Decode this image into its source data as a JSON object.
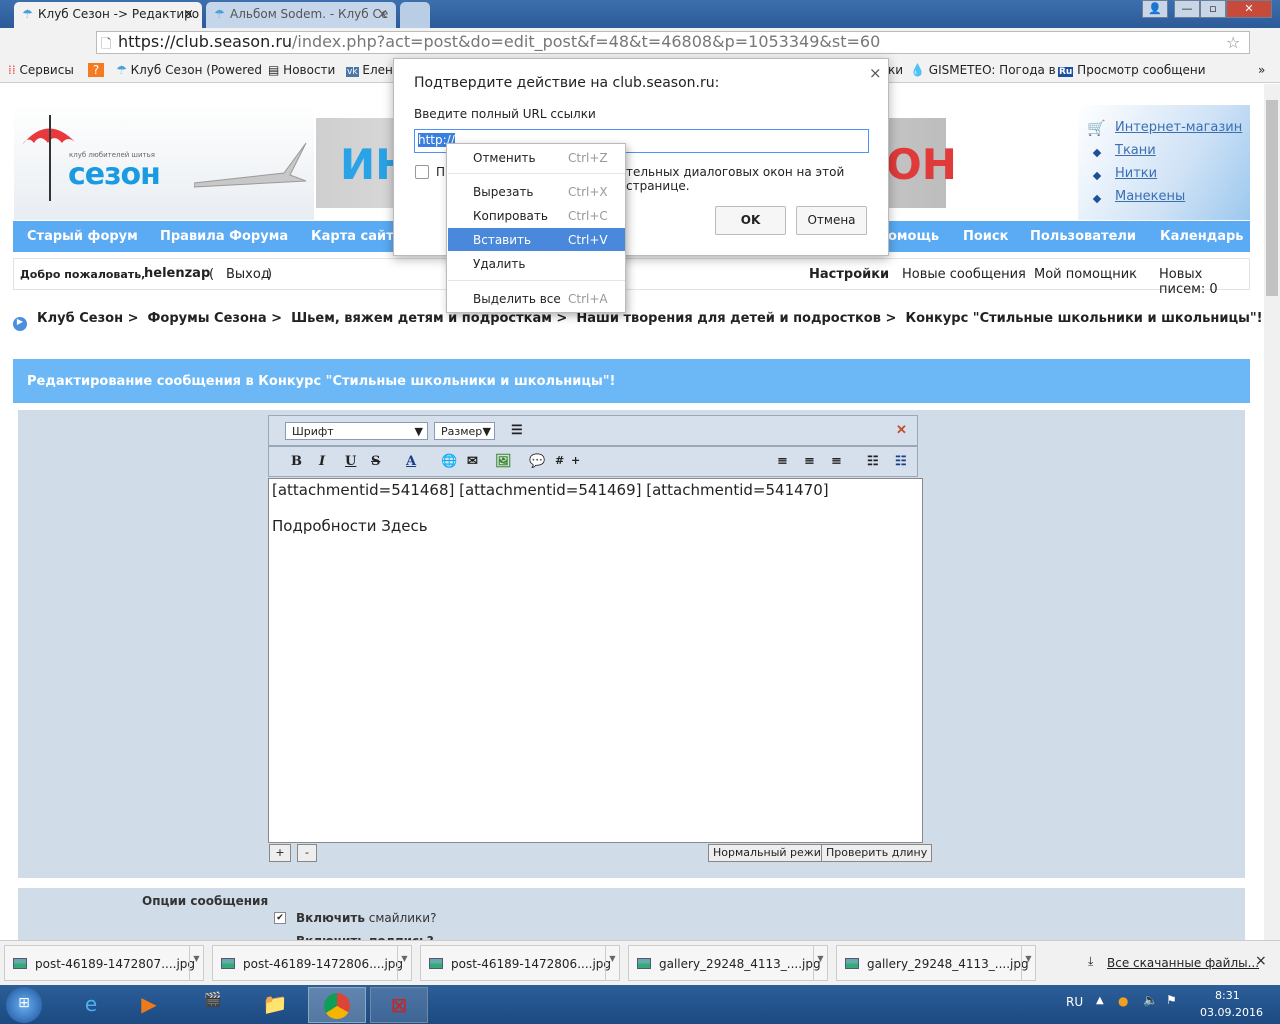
{
  "browser": {
    "tabs": [
      {
        "title": "Клуб Сезон -> Редактиро",
        "close": "×"
      },
      {
        "title": "Альбом Sodem. - Клуб Се",
        "close": "×"
      }
    ],
    "window_buttons": [
      "—",
      "▫",
      "✕"
    ],
    "url_domain": "https://club.season.ru",
    "url_path": "/index.php?act=post&do=edit_post&f=48&t=46808&p=1053349&st=60",
    "bookmarks": [
      "Сервисы",
      "Клуб Сезон (Powered",
      "Новости",
      "Елен",
      "ки",
      "GISMETEO: Погода в",
      "Просмотр сообщени"
    ],
    "bookmarks_more": "»"
  },
  "header": {
    "logo_tagline": "клуб любителей шитья",
    "logo_text": "сезон",
    "banner_text_left": "ИН",
    "banner_text_right": "ОН",
    "shop_links": [
      "Интернет-магазин",
      "Ткани",
      "Нитки",
      "Манекены"
    ]
  },
  "nav": [
    "Старый форум",
    "Правила Форума",
    "Карта сайт",
    "омощь",
    "Поиск",
    "Пользователи",
    "Календарь"
  ],
  "userbar": {
    "welcome": "Добро пожаловать,",
    "user": "helenzap",
    "paren_open": "(",
    "logout": "Выход",
    "paren_close": ")",
    "settings": "Настройки",
    "new_posts": "Новые сообщения",
    "assistant": "Мой помощник",
    "new_mail": "Новых писем: 0"
  },
  "breadcrumb": [
    "Клуб Сезон >",
    "Форумы Сезона >",
    "Шьем, вяжем детям и подросткам >",
    "Наши творения для детей и подростков >",
    "Конкурс \"Стильные школьники и школьницы\"!"
  ],
  "page_title": "Редактирование сообщения в Конкурс \"Стильные школьники и школьницы\"!",
  "editor": {
    "font": "Шрифт",
    "size": "Размер",
    "content": "[attachmentid=541468] [attachmentid=541469] [attachmentid=541470]\n\nПодробности Здесь",
    "plus": "+",
    "minus": "-",
    "normal_mode": "Нормальный режим",
    "check_length": "Проверить длину"
  },
  "options": {
    "title": "Опции сообщения",
    "enable_smilies_bold": "Включить",
    "enable_smilies": "смайлики?",
    "enable_sig": "Включить подпись?"
  },
  "dialog": {
    "title": "Подтвердите действие на club.season.ru:",
    "label": "Введите полный URL ссылки",
    "value": "http://",
    "checkbox_prefix": "Пр",
    "checkbox_suffix": "тельных диалоговых окон на этой странице.",
    "ok": "OK",
    "cancel": "Отмена",
    "close": "×"
  },
  "context_menu": [
    {
      "label": "Отменить",
      "shortcut": "Ctrl+Z"
    },
    {
      "label": "Вырезать",
      "shortcut": "Ctrl+X"
    },
    {
      "label": "Копировать",
      "shortcut": "Ctrl+C"
    },
    {
      "label": "Вставить",
      "shortcut": "Ctrl+V"
    },
    {
      "label": "Удалить",
      "shortcut": ""
    },
    {
      "label": "Выделить все",
      "shortcut": "Ctrl+A"
    }
  ],
  "downloads": {
    "items": [
      "post-46189-1472807....jpg",
      "post-46189-1472806....jpg",
      "post-46189-1472806....jpg",
      "gallery_29248_4113_....jpg",
      "gallery_29248_4113_....jpg"
    ],
    "all": "Все скачанные файлы...",
    "close": "×"
  },
  "taskbar": {
    "lang": "RU",
    "time": "8:31",
    "date": "03.09.2016"
  }
}
